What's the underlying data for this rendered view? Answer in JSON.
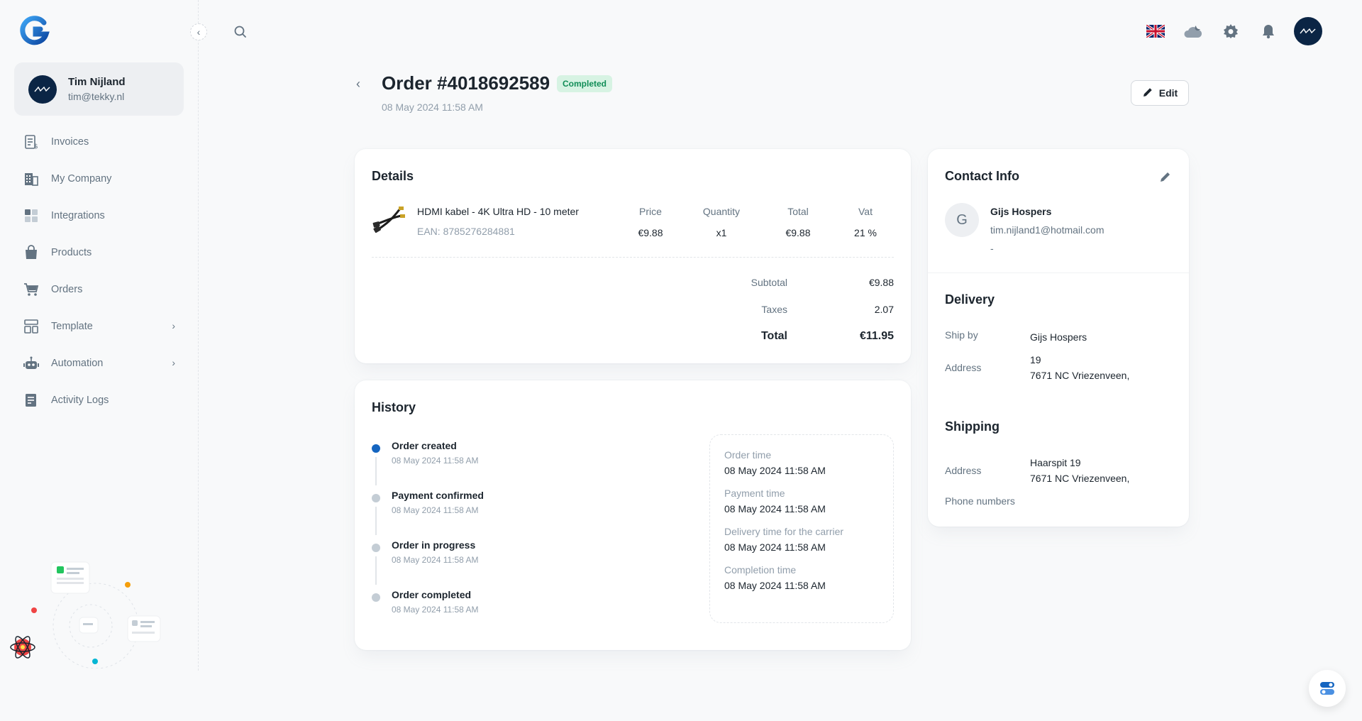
{
  "user": {
    "name": "Tim Nijland",
    "email": "tim@tekky.nl"
  },
  "sidebar": {
    "items": [
      {
        "label": "Invoices",
        "icon": "invoice-icon"
      },
      {
        "label": "My Company",
        "icon": "building-icon"
      },
      {
        "label": "Integrations",
        "icon": "grid-icon"
      },
      {
        "label": "Products",
        "icon": "bag-icon"
      },
      {
        "label": "Orders",
        "icon": "cart-icon"
      },
      {
        "label": "Template",
        "icon": "template-icon",
        "has_children": true
      },
      {
        "label": "Automation",
        "icon": "robot-icon",
        "has_children": true
      },
      {
        "label": "Activity Logs",
        "icon": "log-icon"
      }
    ]
  },
  "order": {
    "title": "Order #4018692589",
    "status": "Completed",
    "date": "08 May 2024 11:58 AM",
    "edit_label": "Edit"
  },
  "details": {
    "title": "Details",
    "product": {
      "name": "HDMI kabel - 4K Ultra HD - 10 meter",
      "ean": "EAN: 8785276284881"
    },
    "columns": [
      {
        "header": "Price",
        "value": "€9.88"
      },
      {
        "header": "Quantity",
        "value": "x1"
      },
      {
        "header": "Total",
        "value": "€9.88"
      },
      {
        "header": "Vat",
        "value": "21 %"
      }
    ],
    "subtotal_label": "Subtotal",
    "subtotal": "€9.88",
    "taxes_label": "Taxes",
    "taxes": "2.07",
    "total_label": "Total",
    "total": "€11.95"
  },
  "history": {
    "title": "History",
    "events": [
      {
        "title": "Order created",
        "time": "08 May 2024 11:58 AM",
        "active": true
      },
      {
        "title": "Payment confirmed",
        "time": "08 May 2024 11:58 AM",
        "active": false
      },
      {
        "title": "Order in progress",
        "time": "08 May 2024 11:58 AM",
        "active": false
      },
      {
        "title": "Order completed",
        "time": "08 May 2024 11:58 AM",
        "active": false
      }
    ],
    "times": [
      {
        "label": "Order time",
        "value": "08 May 2024 11:58 AM"
      },
      {
        "label": "Payment time",
        "value": "08 May 2024 11:58 AM"
      },
      {
        "label": "Delivery time for the carrier",
        "value": "08 May 2024 11:58 AM"
      },
      {
        "label": "Completion time",
        "value": "08 May 2024 11:58 AM"
      }
    ]
  },
  "contact": {
    "title": "Contact Info",
    "initial": "G",
    "name": "Gijs Hospers",
    "email": "tim.nijland1@hotmail.com",
    "phone": "-"
  },
  "delivery": {
    "title": "Delivery",
    "ship_by_label": "Ship by",
    "ship_by": "Gijs Hospers",
    "address_label": "Address",
    "address_line1": "19",
    "address_line2": "7671 NC Vriezenveen,"
  },
  "shipping": {
    "title": "Shipping",
    "address_label": "Address",
    "address_line1": "Haarspit 19",
    "address_line2": "7671 NC Vriezenveen,",
    "phone_label": "Phone numbers"
  },
  "colors": {
    "accent": "#1565c0",
    "success_bg": "#d7f3e3",
    "success_text": "#118d57",
    "brand_dark": "#0b2545"
  }
}
